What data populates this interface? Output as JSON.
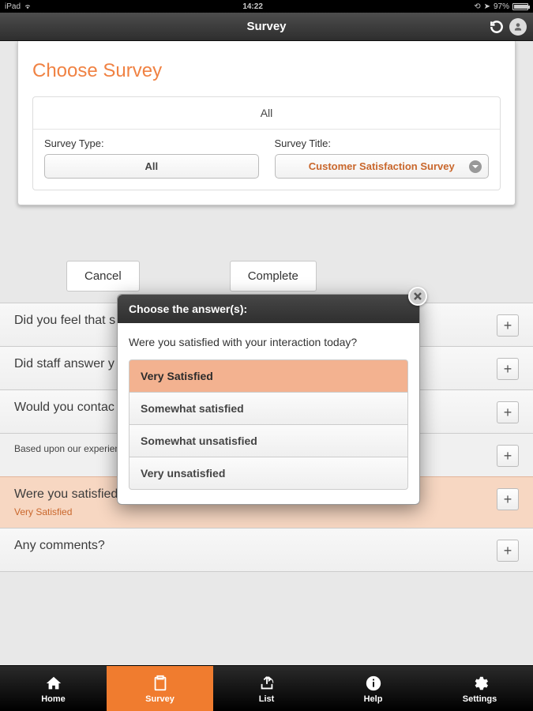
{
  "status": {
    "device": "iPad",
    "time": "14:22",
    "battery": "97%"
  },
  "nav": {
    "title": "Survey"
  },
  "panel": {
    "title": "Choose Survey",
    "all_label": "All",
    "type_label": "Survey Type:",
    "type_value": "All",
    "title_label": "Survey Title:",
    "title_value": "Customer Satisfaction Survey"
  },
  "buttons": {
    "cancel": "Cancel",
    "complete": "Complete"
  },
  "questions": [
    {
      "text": "Did you feel that s",
      "sub": "",
      "highlight": false,
      "small": false
    },
    {
      "text": "Did staff answer y",
      "sub": "",
      "highlight": false,
      "small": false
    },
    {
      "text": "Would you contac",
      "sub": "",
      "highlight": false,
      "small": false
    },
    {
      "text": "Based upon our experien                                                                                     to a peer?",
      "sub": "",
      "highlight": false,
      "small": true
    },
    {
      "text": "Were you satisfied with your interaction today?",
      "sub": "Very Satisfied",
      "highlight": true,
      "small": false
    },
    {
      "text": "Any comments?",
      "sub": "",
      "highlight": false,
      "small": false
    }
  ],
  "popover": {
    "header": "Choose the answer(s):",
    "question": "Were you satisfied with your interaction today?",
    "options": [
      {
        "label": "Very Satisfied",
        "selected": true
      },
      {
        "label": "Somewhat satisfied",
        "selected": false
      },
      {
        "label": "Somewhat unsatisfied",
        "selected": false
      },
      {
        "label": "Very unsatisfied",
        "selected": false
      }
    ]
  },
  "tabs": [
    {
      "label": "Home",
      "icon": "home",
      "active": false
    },
    {
      "label": "Survey",
      "icon": "clipboard",
      "active": true
    },
    {
      "label": "List",
      "icon": "share",
      "active": false
    },
    {
      "label": "Help",
      "icon": "info",
      "active": false
    },
    {
      "label": "Settings",
      "icon": "gear",
      "active": false
    }
  ]
}
